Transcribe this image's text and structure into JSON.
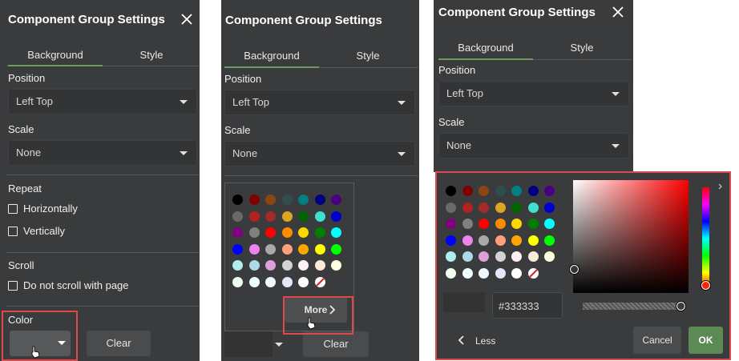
{
  "dialog": {
    "title": "Component Group Settings",
    "tabs": [
      "Background",
      "Style"
    ],
    "position_label": "Position",
    "position_value": "Left Top",
    "scale_label": "Scale",
    "scale_value": "None",
    "repeat_label": "Repeat",
    "horizontally_label": "Horizontally",
    "vertically_label": "Vertically",
    "scroll_label": "Scroll",
    "no_scroll_label": "Do not scroll with page",
    "color_label": "Color",
    "clear_label": "Clear"
  },
  "palette": {
    "more_label": "More",
    "less_label": "Less",
    "cancel_label": "Cancel",
    "ok_label": "OK",
    "hex_value": "#333333",
    "selected_color": "#333333",
    "colors": [
      [
        "#000000",
        "#800000",
        "#8b4513",
        "#2f4f4f",
        "#008080",
        "#000080",
        "#4b0082"
      ],
      [
        "#696969",
        "#b22222",
        "#a52a2a",
        "#daa520",
        "#006400",
        "#40e0d0",
        "#0000cd"
      ],
      [
        "#800080",
        "#808080",
        "#ff0000",
        "#ff8c00",
        "#ffd700",
        "#008000",
        "#00ffff"
      ],
      [
        "#0000ff",
        "#ee82ee",
        "#a9a9a9",
        "#ffa07a",
        "#ffa500",
        "#ffff00",
        "#00ff00"
      ],
      [
        "#afeeee",
        "#add8e6",
        "#dda0dd",
        "#d3d3d3",
        "#fff0f5",
        "#faebd7",
        "#ffffe0"
      ],
      [
        "#f0fff0",
        "#f0ffff",
        "#f0f8ff",
        "#e6e6fa",
        "#ffffff",
        "none"
      ]
    ]
  }
}
